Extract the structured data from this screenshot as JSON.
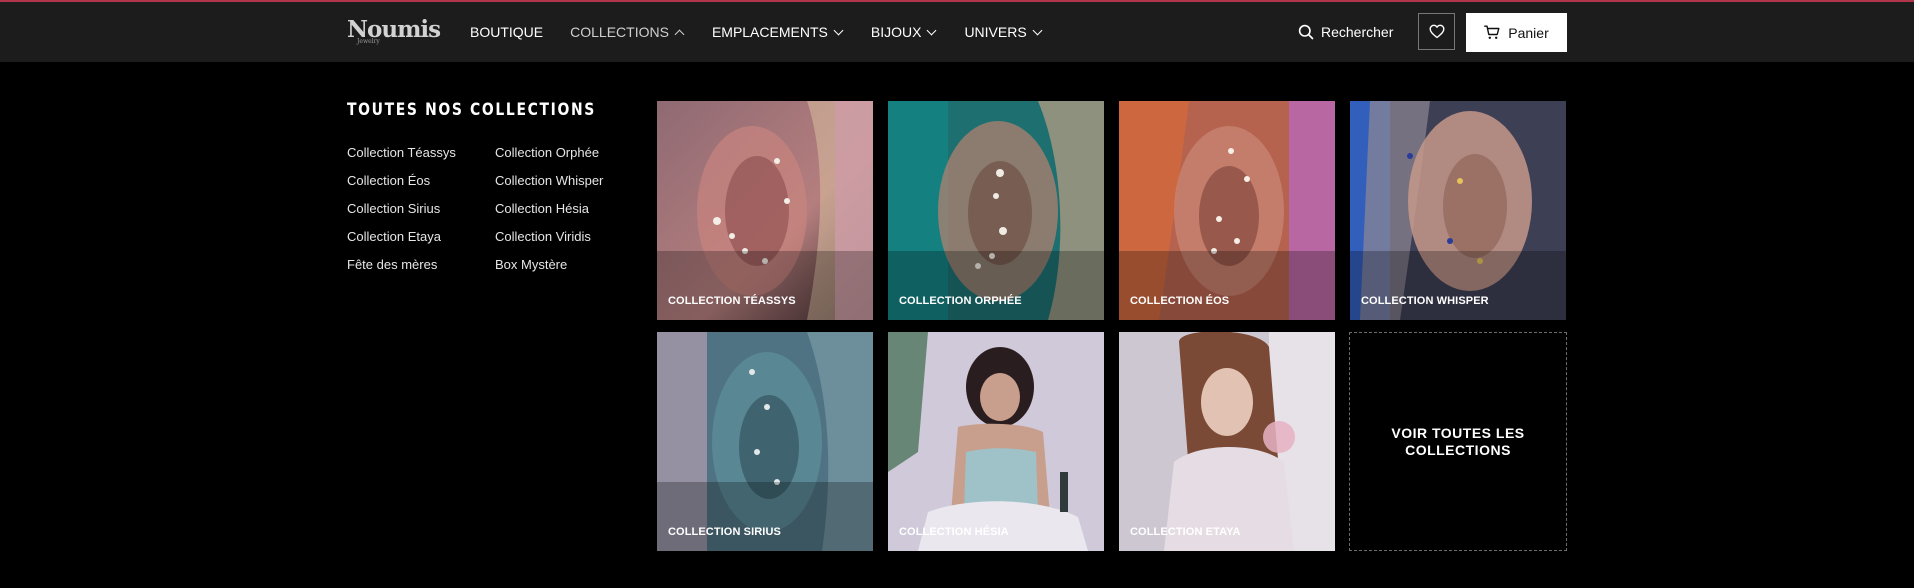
{
  "brand": {
    "name": "Noumis",
    "sub": "Jewelry"
  },
  "nav": [
    {
      "label": "BOUTIQUE",
      "chevron": "none"
    },
    {
      "label": "COLLECTIONS",
      "chevron": "up"
    },
    {
      "label": "EMPLACEMENTS",
      "chevron": "down"
    },
    {
      "label": "BIJOUX",
      "chevron": "down"
    },
    {
      "label": "UNIVERS",
      "chevron": "down"
    }
  ],
  "header": {
    "search_label": "Rechercher",
    "cart_label": "Panier",
    "icons": [
      "search-icon",
      "heart-icon",
      "cart-icon"
    ]
  },
  "menu": {
    "title": "TOUTES NOS COLLECTIONS",
    "col1": [
      "Collection Téassys",
      "Collection Éos",
      "Collection Sirius",
      "Collection Etaya",
      "Fête des mères"
    ],
    "col2": [
      "Collection Orphée",
      "Collection Whisper",
      "Collection Hésia",
      "Collection Viridis",
      "Box Mystère"
    ]
  },
  "tiles": [
    {
      "label": "COLLECTION TÉASSYS",
      "bg": "#b06f8d"
    },
    {
      "label": "COLLECTION ORPHÉE",
      "bg": "#2a7e79"
    },
    {
      "label": "COLLECTION ÉOS",
      "bg": "#c2614f"
    },
    {
      "label": "COLLECTION WHISPER",
      "bg": "#5e6a86"
    },
    {
      "label": "COLLECTION SIRIUS",
      "bg": "#5f7c8a"
    },
    {
      "label": "COLLECTION HÉSIA",
      "bg": "#c9c4d6"
    },
    {
      "label": "COLLECTION ETAYA",
      "bg": "#c8c2cc"
    }
  ],
  "view_all": "VOIR TOUTES LES COLLECTIONS",
  "colors": {
    "accent_line": "#b0354a",
    "header_bg": "#1c1c1c",
    "page_bg": "#000000"
  }
}
